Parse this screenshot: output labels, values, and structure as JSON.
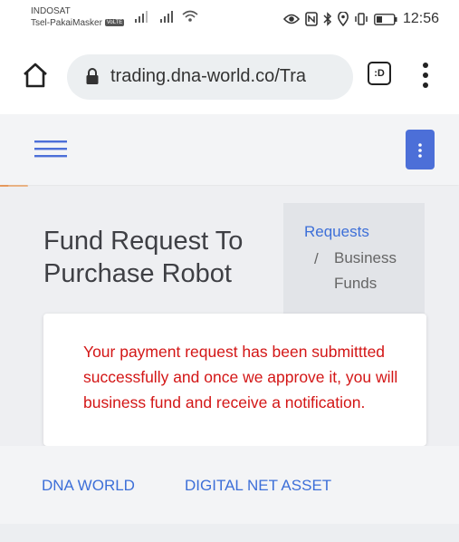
{
  "status_bar": {
    "carrier_name": "INDOSAT",
    "carrier_sub": "Tsel-PakaiMasker",
    "volte_badge": "VoLTE",
    "time": "12:56"
  },
  "browser": {
    "url": "trading.dna-world.co/Tra",
    "tab_label": ":D"
  },
  "page": {
    "title": "Fund Request To Purchase Robot",
    "breadcrumb": {
      "link": "Requests",
      "separator": "/",
      "current": "Business Funds"
    },
    "alert_message": "Your payment request has been submittted successfully and once we approve it, you will business fund and receive a notification."
  },
  "footer": {
    "links": [
      "DNA WORLD",
      "DIGITAL NET ASSET"
    ]
  },
  "colors": {
    "accent": "#4c6fd8",
    "link": "#3d6fd8",
    "alert_text": "#d31616",
    "brand_orange": "#f0a060"
  },
  "icons": {
    "status": [
      "signal-icon",
      "wifi-icon",
      "eye-icon",
      "nfc-icon",
      "bluetooth-icon",
      "location-icon",
      "vibrate-icon",
      "battery-icon"
    ],
    "browser": [
      "home-icon",
      "lock-icon",
      "tab-switcher-icon",
      "more-vert-icon"
    ],
    "site": [
      "hamburger-icon",
      "kebab-icon"
    ]
  }
}
